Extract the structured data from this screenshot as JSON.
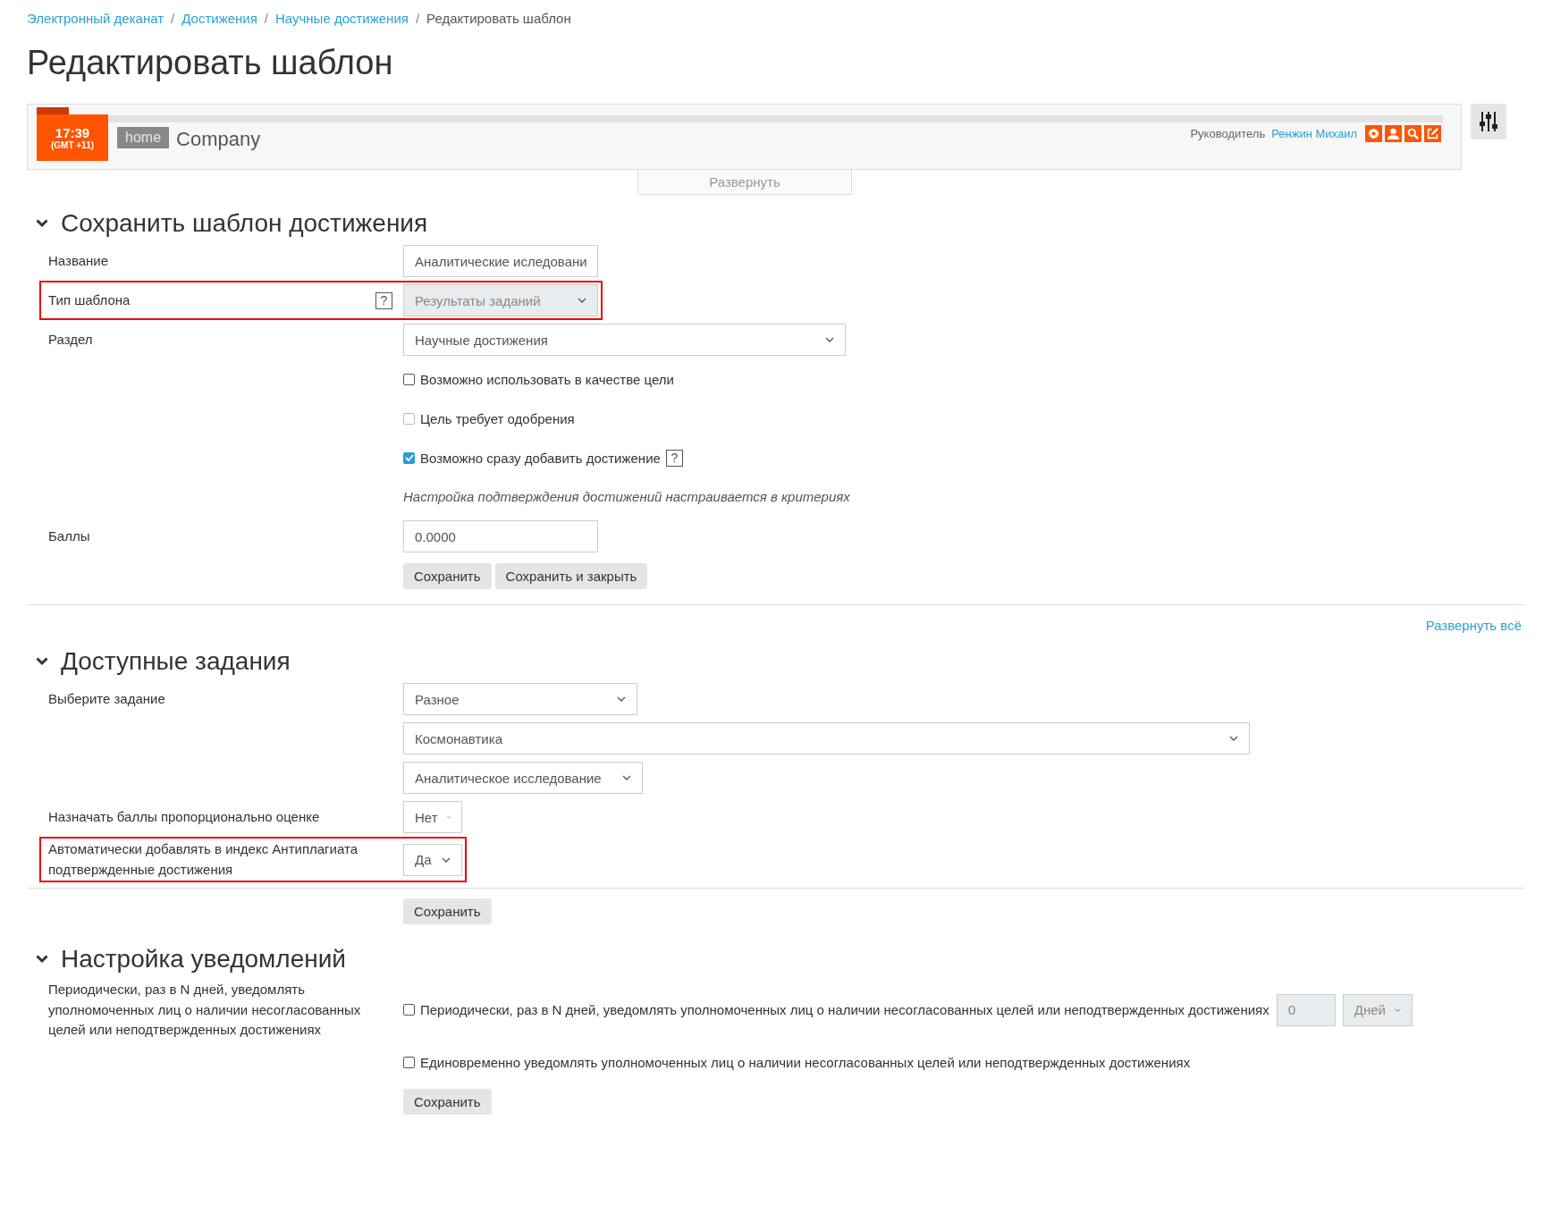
{
  "breadcrumbs": [
    {
      "label": "Электронный деканат",
      "link": true
    },
    {
      "label": "Достижения",
      "link": true
    },
    {
      "label": "Научные достижения",
      "link": true
    },
    {
      "label": "Редактировать шаблон",
      "link": false
    }
  ],
  "breadcrumb_separator": "/",
  "title": "Редактировать шаблон",
  "header": {
    "time": "17:39",
    "timezone": "(GMT +11)",
    "home": "home",
    "company": "Company",
    "role": "Руководитель",
    "user": "Ренжин Михаил",
    "expand": "Развернуть"
  },
  "sections": [
    {
      "title": "Сохранить шаблон достижения",
      "expanded": true,
      "rows": [
        {
          "label": "Название",
          "highlighted": false,
          "controls": [
            {
              "kind": "text",
              "value": "Аналитические иследовани",
              "disabled": false
            }
          ]
        },
        {
          "label": "Тип шаблона",
          "help": "?",
          "highlighted": true,
          "controls": [
            {
              "kind": "select",
              "value": "Результаты заданий",
              "disabled": true
            }
          ]
        },
        {
          "label": "Раздел",
          "highlighted": false,
          "controls": [
            {
              "kind": "select",
              "value": "Научные достижения",
              "disabled": false
            }
          ]
        },
        {
          "highlighted": false,
          "controls": [
            {
              "kind": "checkbox",
              "label": "Возможно использовать в качестве цели",
              "checked": false,
              "disabled": false
            }
          ]
        },
        {
          "highlighted": false,
          "controls": [
            {
              "kind": "checkbox",
              "label": "Цель требует одобрения",
              "checked": false,
              "disabled": true
            }
          ]
        },
        {
          "highlighted": false,
          "controls": [
            {
              "kind": "checkbox",
              "label": "Возможно сразу добавить достижение",
              "checked": true,
              "disabled": false,
              "help": "?"
            }
          ]
        },
        {
          "highlighted": false,
          "controls": [
            {
              "kind": "note",
              "text": "Настройка подтверждения достижений настраивается в критериях"
            }
          ]
        },
        {
          "label": "Баллы",
          "highlighted": false,
          "controls": [
            {
              "kind": "text",
              "value": "0.0000",
              "disabled": false
            }
          ]
        },
        {
          "highlighted": false,
          "controls": [
            {
              "kind": "button",
              "label": "Сохранить"
            },
            {
              "kind": "button",
              "label": "Сохранить и закрыть"
            }
          ]
        }
      ]
    },
    {
      "title": "Доступные задания",
      "expanded": true,
      "expand_all": "Развернуть всё",
      "rows": [
        {
          "label": "Выберите задание",
          "highlighted": false,
          "controls": [
            {
              "kind": "select",
              "value": "Разное",
              "disabled": false
            }
          ]
        },
        {
          "highlighted": false,
          "controls": [
            {
              "kind": "select",
              "value": "Космонавтика",
              "disabled": false
            }
          ]
        },
        {
          "highlighted": false,
          "controls": [
            {
              "kind": "select",
              "value": "Аналитическое исследование",
              "disabled": false
            }
          ]
        },
        {
          "label": "Назначать баллы пропорционально оценке",
          "highlighted": false,
          "controls": [
            {
              "kind": "select",
              "value": "Нет",
              "disabled": false
            }
          ]
        },
        {
          "label": "Автоматически добавлять в индекс Антиплагиата подтвержденные достижения",
          "highlighted": true,
          "controls": [
            {
              "kind": "select",
              "value": "Да",
              "disabled": false
            }
          ]
        },
        {
          "highlighted": false,
          "ruled": true,
          "controls": [
            {
              "kind": "button",
              "label": "Сохранить"
            }
          ]
        }
      ]
    },
    {
      "title": "Настройка уведомлений",
      "expanded": true,
      "rows": [
        {
          "label": "Периодически, раз в N дней, уведомлять уполномоченных лиц о наличии несогласованных целей или неподтвержденных достижениях",
          "highlighted": false,
          "controls": [
            {
              "kind": "checkbox",
              "label": "Периодически, раз в N дней, уведомлять уполномоченных лиц о наличии несогласованных целей или неподтвержденных достижениях",
              "checked": false,
              "disabled": false
            },
            {
              "kind": "text",
              "value": "0",
              "disabled": true
            },
            {
              "kind": "select",
              "value": "Дней",
              "disabled": true
            }
          ]
        },
        {
          "highlighted": false,
          "controls": [
            {
              "kind": "checkbox",
              "label": "Единовременно уведомлять уполномоченных лиц о наличии несогласованных целей или неподтвержденных достижениях",
              "checked": false,
              "disabled": false
            }
          ]
        },
        {
          "highlighted": false,
          "controls": [
            {
              "kind": "button",
              "label": "Сохранить"
            }
          ]
        }
      ]
    }
  ]
}
